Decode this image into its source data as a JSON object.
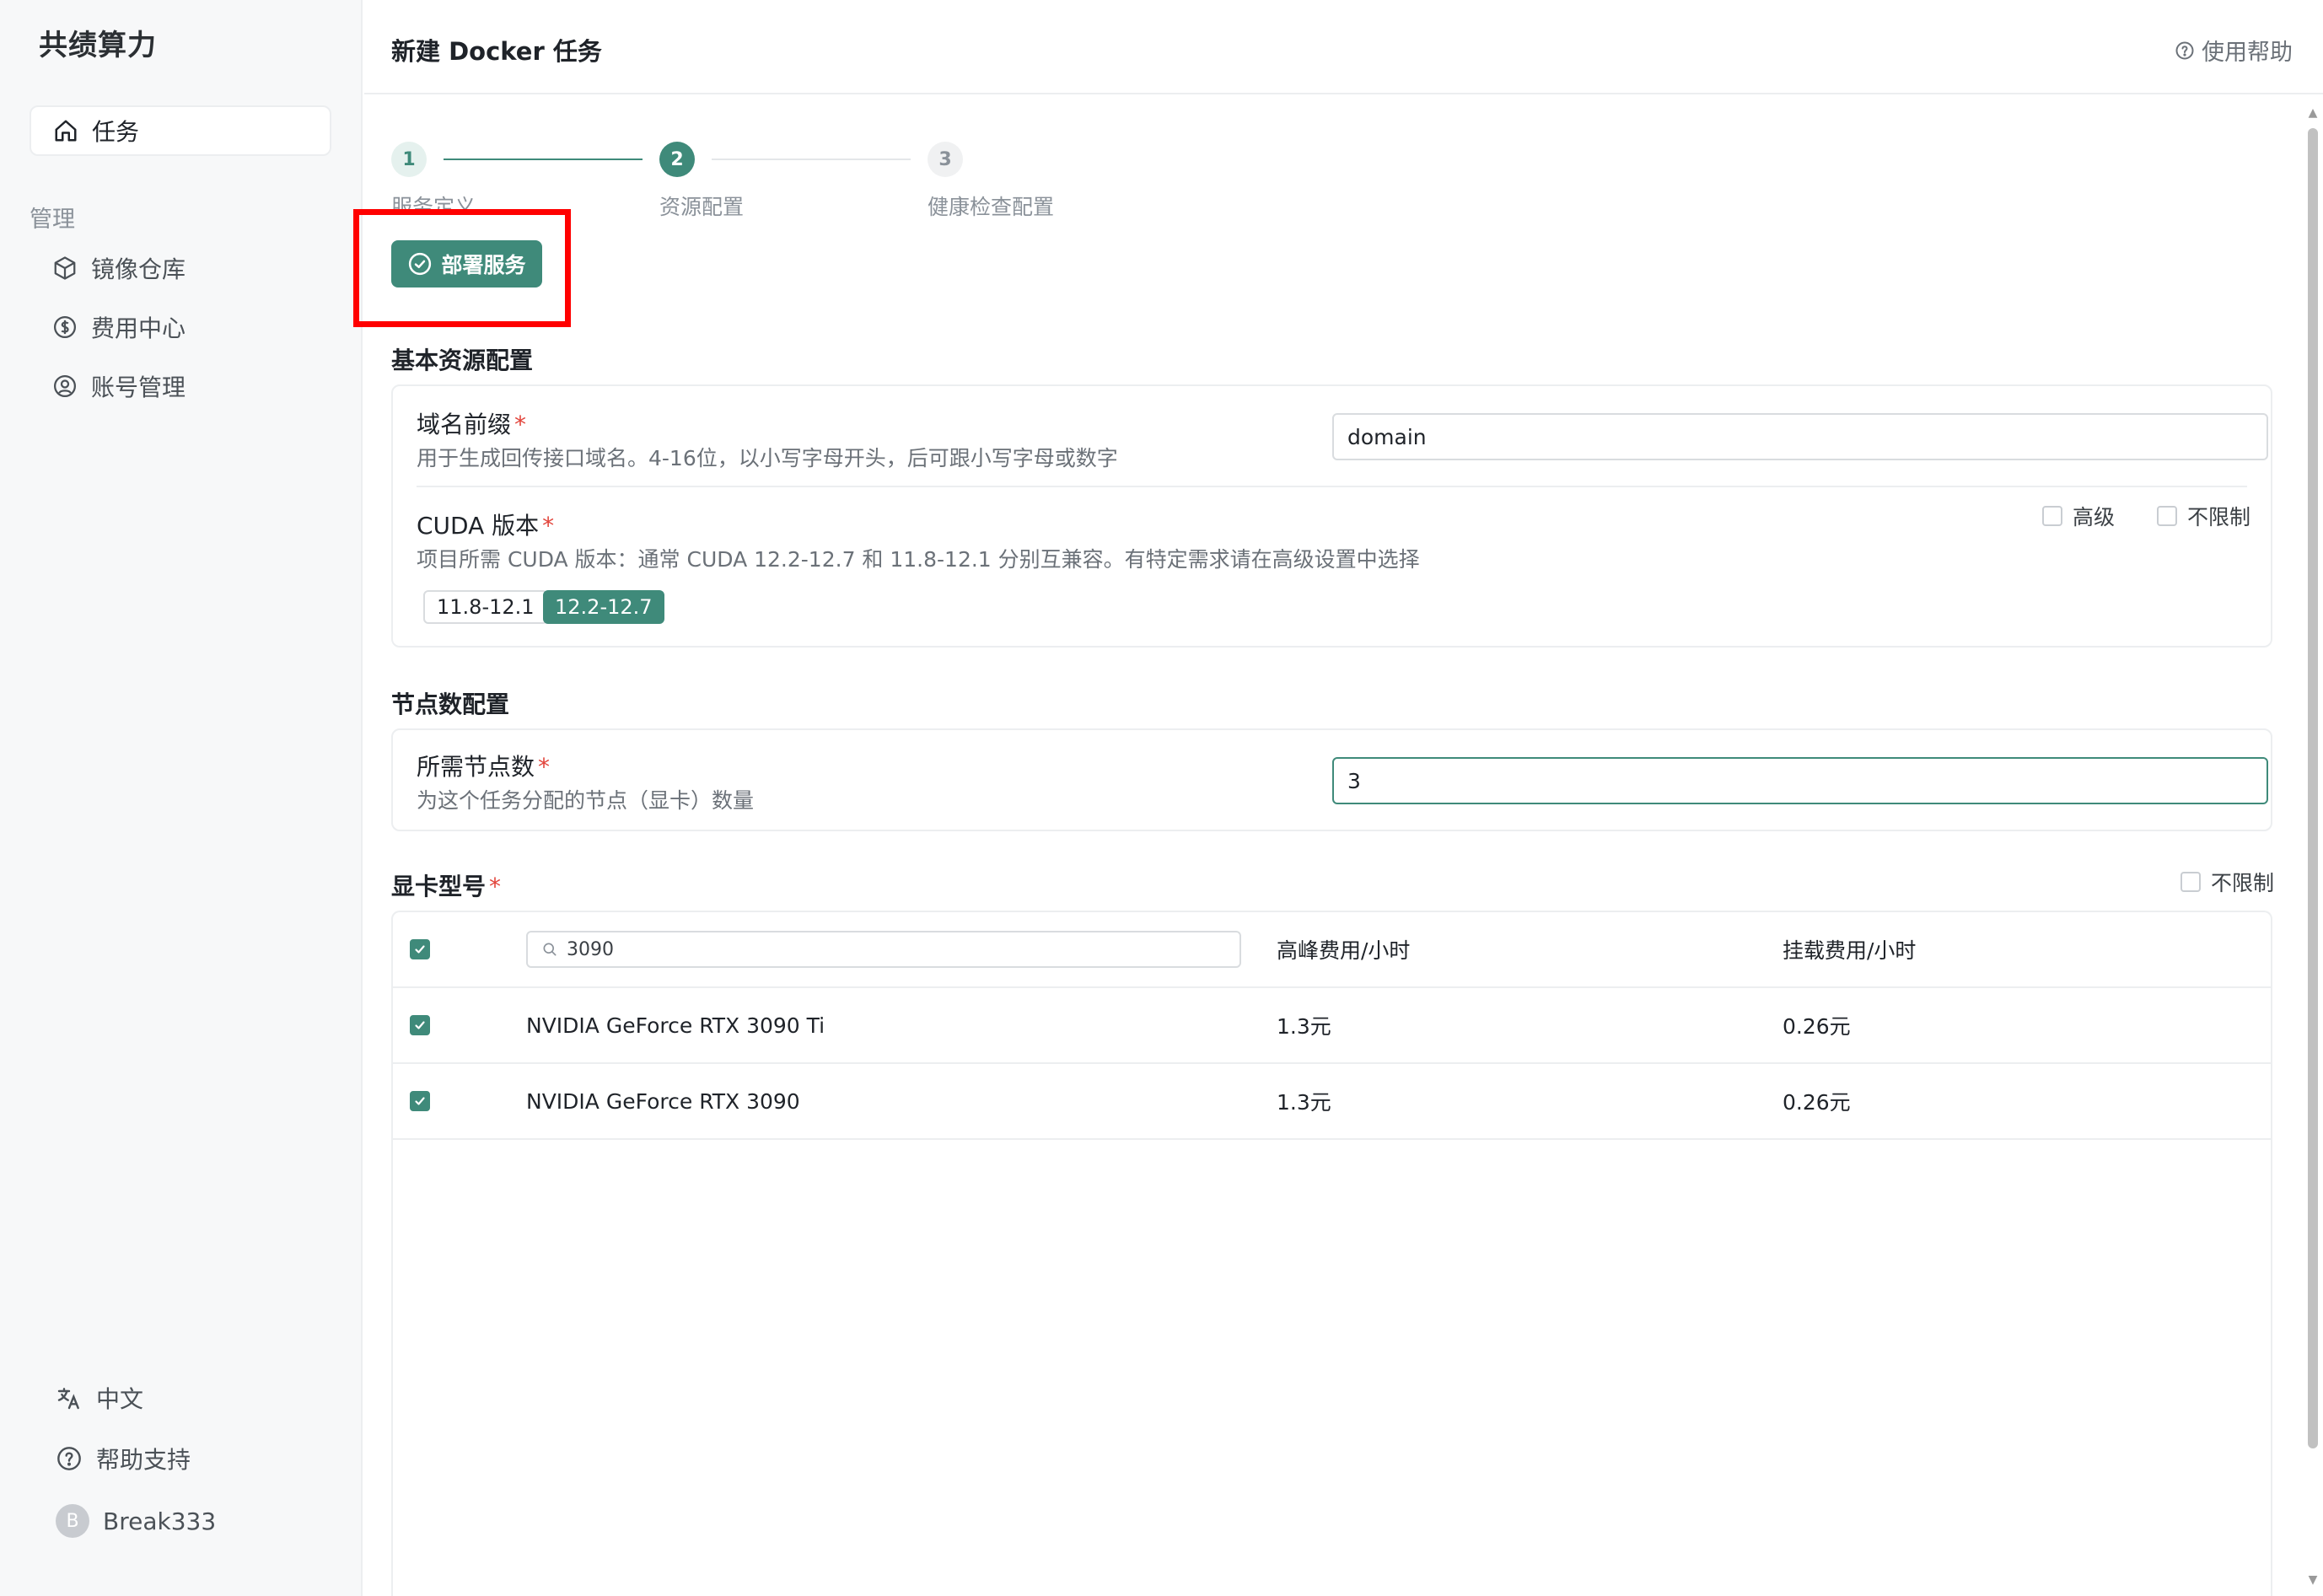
{
  "sidebar": {
    "brand": "共绩算力",
    "active_item": "任务",
    "section_label": "管理",
    "items": [
      {
        "label": "镜像仓库",
        "icon": "box-icon"
      },
      {
        "label": "费用中心",
        "icon": "dollar-icon"
      },
      {
        "label": "账号管理",
        "icon": "user-circle-icon"
      }
    ],
    "bottom": {
      "language": "中文",
      "help": "帮助支持",
      "user_initial": "B",
      "username": "Break333"
    }
  },
  "header": {
    "title": "新建 Docker 任务",
    "help_link": "使用帮助"
  },
  "steps": [
    {
      "number": "1",
      "label": "服务定义",
      "status": "done"
    },
    {
      "number": "2",
      "label": "资源配置",
      "status": "current"
    },
    {
      "number": "3",
      "label": "健康检查配置",
      "status": "wait"
    }
  ],
  "deploy_button": "部署服务",
  "basic_resources": {
    "title": "基本资源配置",
    "domain": {
      "label": "域名前缀",
      "required_mark": "*",
      "description": "用于生成回传接口域名。4-16位，以小写字母开头，后可跟小写字母或数字",
      "value": "domain"
    },
    "cuda": {
      "label": "CUDA 版本",
      "required_mark": "*",
      "description": "项目所需 CUDA 版本：通常 CUDA 12.2-12.7 和 11.8-12.1 分别互兼容。有特定需求请在高级设置中选择",
      "options": [
        "11.8-12.1",
        "12.2-12.7"
      ],
      "selected": "12.2-12.7",
      "advanced_label": "高级",
      "unlimited_label": "不限制"
    }
  },
  "node_config": {
    "title": "节点数配置",
    "label": "所需节点数",
    "required_mark": "*",
    "description": "为这个任务分配的节点（显卡）数量",
    "value": "3"
  },
  "gpu": {
    "title": "显卡型号",
    "required_mark": "*",
    "unlimited_label": "不限制",
    "search_value": "3090",
    "columns": [
      "高峰费用/小时",
      "挂载费用/小时"
    ],
    "rows": [
      {
        "name": "NVIDIA GeForce RTX 3090 Ti",
        "peak": "1.3元",
        "mount": "0.26元",
        "checked": true
      },
      {
        "name": "NVIDIA GeForce RTX 3090",
        "peak": "1.3元",
        "mount": "0.26元",
        "checked": true
      }
    ]
  },
  "colors": {
    "accent": "#3f8a7a",
    "required": "#e2453c",
    "highlight": "#ff0000"
  }
}
